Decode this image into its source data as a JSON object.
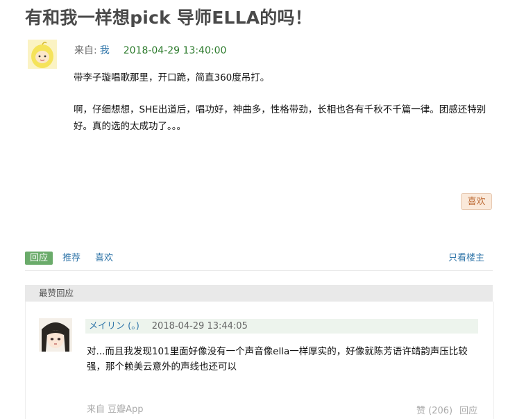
{
  "topic": {
    "title": "有和我一样想pick 导师ELLA的吗！",
    "from_label": "来自:",
    "author": "我",
    "time": "2018-04-29 13:40:00",
    "paragraphs": [
      "带李子璇唱歌那里，开口跪，简直360度吊打。",
      "啊，仔细想想，SHE出道后，唱功好，神曲多，性格带劲，长相也各有千秋不千篇一律。团感还特别好。真的选的太成功了。。。"
    ],
    "like_label": "喜欢"
  },
  "actions": {
    "reply_label": "回应",
    "recommend_label": "推荐",
    "like_label": "喜欢",
    "only_op_label": "只看楼主"
  },
  "best_replies": {
    "header": "最赞回应",
    "items": [
      {
        "author": "メイリン (。)",
        "time": "2018-04-29 13:44:05",
        "text": "对...而且我发现101里面好像没有一个声音像ella一样厚实的，好像就陈芳语许靖韵声压比较强，那个赖美云意外的声线也还可以",
        "source": "来自 豆瓣App",
        "vote_label": "赞 (206)",
        "reply_label": "回应"
      }
    ]
  },
  "colors": {
    "link": "#3377aa",
    "time_green": "#2b7a2b",
    "reply_tag_bg": "#6aab6a",
    "like_btn_bg": "#fae9da"
  }
}
